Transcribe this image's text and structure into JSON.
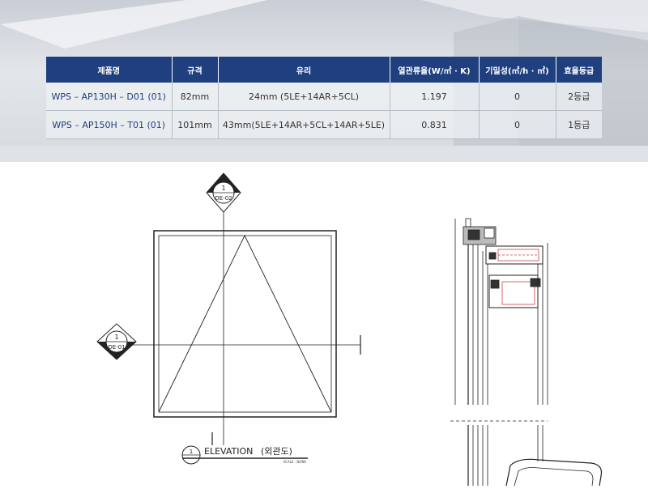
{
  "table": {
    "headers": [
      "제품명",
      "규격",
      "유리",
      "열관류율(W/㎡ · K)",
      "기밀성(㎥/h · ㎡)",
      "효율등급"
    ],
    "rows": [
      [
        "WPS – AP130H – D01 (01)",
        "82mm",
        "24mm (5LE+14AR+5CL)",
        "1.197",
        "0",
        "2등급"
      ],
      [
        "WPS – AP150H – T01 (01)",
        "101mm",
        "43mm(5LE+14AR+5CL+14AR+5LE)",
        "0.831",
        "0",
        "1등급"
      ]
    ]
  },
  "drawing": {
    "section_marker_top": {
      "number": "1",
      "ref": "DE-02"
    },
    "section_marker_left": {
      "number": "1",
      "ref": "DE-01"
    },
    "elevation_number": "1",
    "elevation_title": "ELEVATION",
    "elevation_subtitle": "(외관도)",
    "scale_note": "SCALE : NONE"
  },
  "colors": {
    "header_bg": "#1f3f7f",
    "brand_text": "#1f3f7f"
  }
}
